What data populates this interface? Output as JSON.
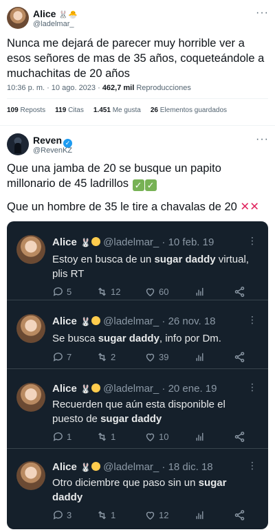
{
  "tweet1": {
    "name": "Alice",
    "name_emoji": "🐰🐣",
    "handle": "@ladelmar_",
    "more": "···",
    "text": "Nunca me dejará de parecer muy horrible ver a esos señores de mas de 35 años, coqueteándole a muchachitas de 20 años",
    "time": "10:36 p. m. · 10 ago. 2023 · ",
    "views_count": "462,7 mil",
    "views_label": " Reproducciones",
    "stats": [
      {
        "count": "109",
        "label": "Reposts"
      },
      {
        "count": "119",
        "label": "Citas"
      },
      {
        "count": "1.451",
        "label": "Me gusta"
      },
      {
        "count": "26",
        "label": "Elementos guardados"
      }
    ]
  },
  "tweet2": {
    "name": "Reven",
    "verified": "✓",
    "handle": "@RevenKZ",
    "more": "···",
    "line1": "Que una jamba de 20 se busque un papito millonario de 45 ladrillos",
    "check": "✓",
    "line2": "Que un hombre de 35 le tire a chavalas de 20",
    "cross": "✕✕"
  },
  "embedded": [
    {
      "name": "Alice",
      "handle": "@ladelmar_",
      "date": " · 10 feb. 19",
      "pre": "Estoy en busca de un ",
      "bold": "sugar daddy",
      "post": " virtual, plis RT",
      "replies": "5",
      "retweets": "12",
      "likes": "60"
    },
    {
      "name": "Alice",
      "handle": "@ladelmar_",
      "date": " · 26 nov. 18",
      "pre": "Se busca ",
      "bold": "sugar daddy",
      "post": ", info por Dm.",
      "replies": "7",
      "retweets": "2",
      "likes": "39"
    },
    {
      "name": "Alice",
      "handle": "@ladelmar_",
      "date": " · 20 ene. 19",
      "pre": "Recuerden que aún esta disponible el puesto de ",
      "bold": "sugar daddy",
      "post": "",
      "replies": "1",
      "retweets": "1",
      "likes": "10"
    },
    {
      "name": "Alice",
      "handle": "@ladelmar_",
      "date": " · 18 dic. 18",
      "pre": "Otro diciembre que paso sin un ",
      "bold": "sugar daddy",
      "post": "",
      "replies": "3",
      "retweets": "1",
      "likes": "12"
    }
  ],
  "colors": {
    "dark_bg": "#15202b",
    "twitter_blue": "#1d9bf0"
  }
}
